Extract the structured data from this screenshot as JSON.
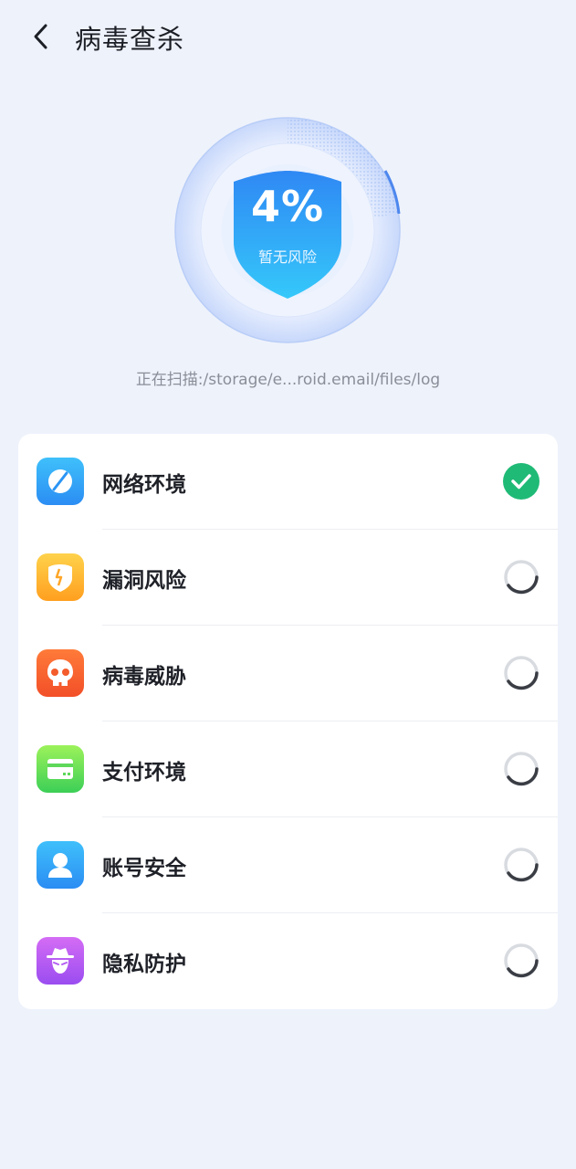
{
  "header": {
    "title": "病毒查杀"
  },
  "scan": {
    "progress_label": "4%",
    "progress": 4,
    "risk_label": "暂无风险",
    "path_text": "正在扫描:/storage/e...roid.email/files/log"
  },
  "items": [
    {
      "label": "网络环境",
      "icon": "network-icon",
      "status": "done"
    },
    {
      "label": "漏洞风险",
      "icon": "vulnerability-icon",
      "status": "loading"
    },
    {
      "label": "病毒威胁",
      "icon": "virus-skull-icon",
      "status": "loading"
    },
    {
      "label": "支付环境",
      "icon": "payment-card-icon",
      "status": "loading"
    },
    {
      "label": "账号安全",
      "icon": "account-user-icon",
      "status": "loading"
    },
    {
      "label": "隐私防护",
      "icon": "privacy-spy-icon",
      "status": "loading"
    }
  ],
  "colors": {
    "success": "#1fba76",
    "shield_top": "#2f88f4",
    "shield_bottom": "#35c8fa"
  }
}
